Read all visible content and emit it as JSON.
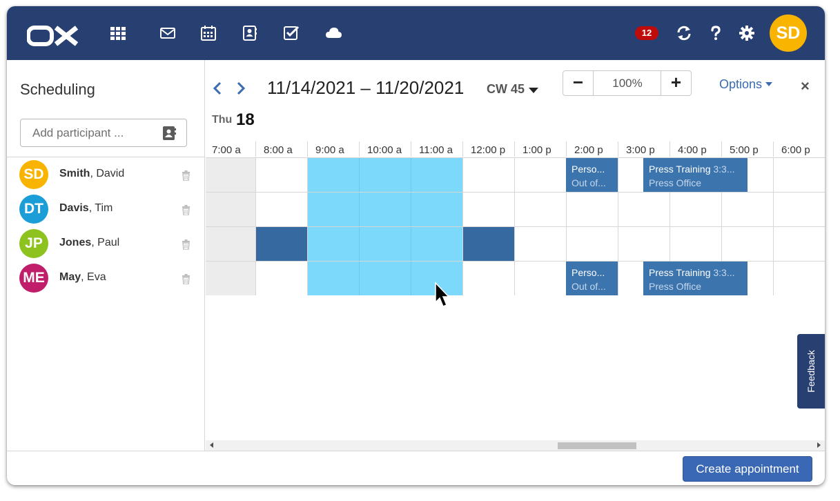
{
  "app": {
    "logo_text": "OX",
    "notification_count": "12",
    "user_initials": "SD",
    "colors": {
      "topbar": "#283f71",
      "accent": "#3a68b5",
      "selection": "#7dd9fb",
      "busy": "#36699f"
    }
  },
  "nav_icons": [
    "apps-grid-icon",
    "mail-icon",
    "calendar-icon",
    "address-book-icon",
    "tasks-icon",
    "drive-cloud-icon"
  ],
  "header_icons": [
    "refresh-icon",
    "help-icon",
    "settings-gear-icon"
  ],
  "scheduling": {
    "title": "Scheduling",
    "add_participant_placeholder": "Add participant ...",
    "date_range": "11/14/2021 – 11/20/2021",
    "calendar_week": "CW 45",
    "zoom_value": "100%",
    "zoom_minus": "−",
    "zoom_plus": "+",
    "options_label": "Options",
    "close_label": "×",
    "day_name": "Thu",
    "day_number": "18",
    "hours": [
      "7:00 a",
      "8:00 a",
      "9:00 a",
      "10:00 a",
      "11:00 a",
      "12:00 p",
      "1:00 p",
      "2:00 p",
      "3:00 p",
      "4:00 p",
      "5:00 p",
      "6:00 p"
    ]
  },
  "participants": [
    {
      "initials": "SD",
      "last": "Smith",
      "first": ", David",
      "color": "#f8b400"
    },
    {
      "initials": "DT",
      "last": "Davis",
      "first": ", Tim",
      "color": "#1b9ed8"
    },
    {
      "initials": "JP",
      "last": "Jones",
      "first": ", Paul",
      "color": "#8dc21f"
    },
    {
      "initials": "ME",
      "last": "May",
      "first": ", Eva",
      "color": "#c01e6b"
    }
  ],
  "appointments": [
    {
      "title": "Perso...",
      "subtitle": "Out of..."
    },
    {
      "title": "Press Training",
      "time": "3:3...",
      "subtitle": "Press Office"
    },
    {
      "title": "Perso...",
      "subtitle": "Out of..."
    },
    {
      "title": "Press Training",
      "time": "3:3...",
      "subtitle": "Press Office"
    }
  ],
  "footer": {
    "create_label": "Create appointment"
  },
  "feedback_label": "Feedback"
}
